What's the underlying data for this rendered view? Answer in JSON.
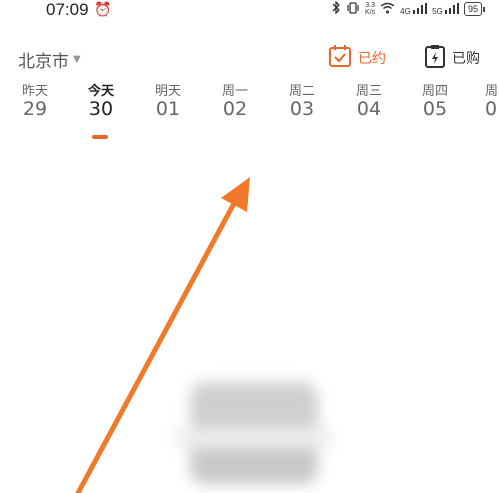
{
  "status_bar": {
    "time": "07:09",
    "net_speed_value": "3.3",
    "net_speed_unit": "K/s",
    "signal1_label": "4G",
    "signal2_label": "5G",
    "battery": "95"
  },
  "header": {
    "city": "北京市",
    "booked_label": "已约",
    "bought_label": "已购"
  },
  "dates": [
    {
      "name": "昨天",
      "num": "29"
    },
    {
      "name": "今天",
      "num": "30"
    },
    {
      "name": "明天",
      "num": "01"
    },
    {
      "name": "周一",
      "num": "02"
    },
    {
      "name": "周二",
      "num": "03"
    },
    {
      "name": "周三",
      "num": "04"
    },
    {
      "name": "周四",
      "num": "05"
    },
    {
      "name": "周",
      "num": "0"
    }
  ],
  "selected_date_index": 1,
  "colors": {
    "accent": "#e8672a",
    "annotation_arrow": "#f07a2a"
  },
  "icons": {
    "alarm": "alarm-clock-icon",
    "bluetooth": "bluetooth-icon",
    "vibrate": "vibrate-icon",
    "wifi": "wifi-icon",
    "booked": "calendar-check-icon",
    "bought": "ticket-bolt-icon"
  }
}
